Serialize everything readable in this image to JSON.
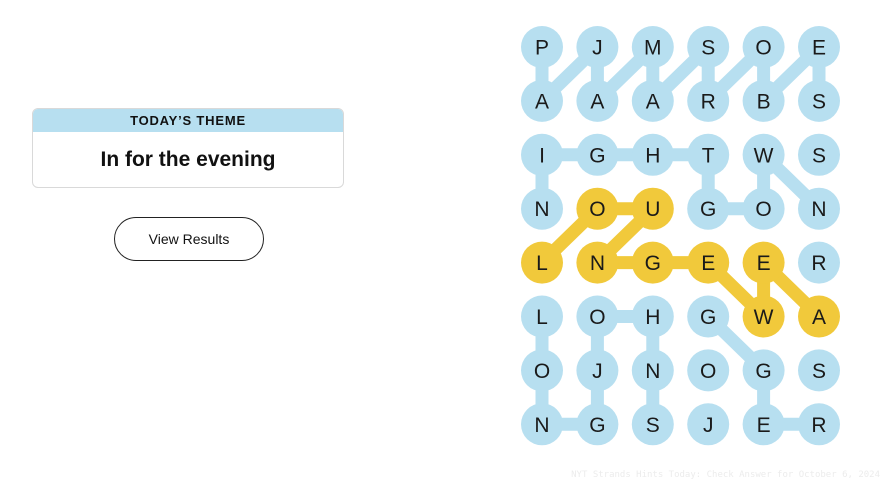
{
  "theme": {
    "header": "TODAY’S THEME",
    "title": "In for the evening"
  },
  "results_button": {
    "label": "View Results"
  },
  "board": {
    "rows": 8,
    "cols": 6,
    "letters": [
      [
        "P",
        "J",
        "M",
        "S",
        "O",
        "E"
      ],
      [
        "A",
        "A",
        "A",
        "R",
        "B",
        "S"
      ],
      [
        "I",
        "G",
        "H",
        "T",
        "W",
        "S"
      ],
      [
        "N",
        "O",
        "U",
        "G",
        "O",
        "N"
      ],
      [
        "L",
        "N",
        "G",
        "E",
        "E",
        "R"
      ],
      [
        "L",
        "O",
        "H",
        "G",
        "W",
        "A"
      ],
      [
        "O",
        "J",
        "N",
        "O",
        "G",
        "S"
      ],
      [
        "N",
        "G",
        "S",
        "J",
        "E",
        "R"
      ]
    ],
    "highlighted": [
      [
        3,
        1
      ],
      [
        3,
        2
      ],
      [
        4,
        0
      ],
      [
        4,
        1
      ],
      [
        4,
        2
      ],
      [
        4,
        3
      ],
      [
        4,
        4
      ],
      [
        5,
        4
      ],
      [
        5,
        5
      ]
    ],
    "links": [
      {
        "from": [
          0,
          0
        ],
        "to": [
          1,
          0
        ],
        "color": "blue"
      },
      {
        "from": [
          1,
          0
        ],
        "to": [
          0,
          1
        ],
        "color": "blue"
      },
      {
        "from": [
          0,
          1
        ],
        "to": [
          1,
          1
        ],
        "color": "blue"
      },
      {
        "from": [
          1,
          1
        ],
        "to": [
          0,
          2
        ],
        "color": "blue"
      },
      {
        "from": [
          0,
          2
        ],
        "to": [
          1,
          2
        ],
        "color": "blue"
      },
      {
        "from": [
          1,
          2
        ],
        "to": [
          0,
          3
        ],
        "color": "blue"
      },
      {
        "from": [
          0,
          3
        ],
        "to": [
          1,
          3
        ],
        "color": "blue"
      },
      {
        "from": [
          1,
          3
        ],
        "to": [
          0,
          4
        ],
        "color": "blue"
      },
      {
        "from": [
          0,
          4
        ],
        "to": [
          1,
          4
        ],
        "color": "blue"
      },
      {
        "from": [
          1,
          4
        ],
        "to": [
          0,
          5
        ],
        "color": "blue"
      },
      {
        "from": [
          0,
          5
        ],
        "to": [
          1,
          5
        ],
        "color": "blue"
      },
      {
        "from": [
          2,
          0
        ],
        "to": [
          2,
          1
        ],
        "color": "blue"
      },
      {
        "from": [
          2,
          1
        ],
        "to": [
          2,
          2
        ],
        "color": "blue"
      },
      {
        "from": [
          2,
          2
        ],
        "to": [
          2,
          3
        ],
        "color": "blue"
      },
      {
        "from": [
          2,
          3
        ],
        "to": [
          3,
          3
        ],
        "color": "blue"
      },
      {
        "from": [
          3,
          3
        ],
        "to": [
          3,
          4
        ],
        "color": "blue"
      },
      {
        "from": [
          3,
          4
        ],
        "to": [
          2,
          4
        ],
        "color": "blue"
      },
      {
        "from": [
          2,
          4
        ],
        "to": [
          3,
          5
        ],
        "color": "blue"
      },
      {
        "from": [
          2,
          0
        ],
        "to": [
          3,
          0
        ],
        "color": "blue"
      },
      {
        "from": [
          5,
          0
        ],
        "to": [
          6,
          0
        ],
        "color": "blue"
      },
      {
        "from": [
          6,
          0
        ],
        "to": [
          7,
          0
        ],
        "color": "blue"
      },
      {
        "from": [
          7,
          0
        ],
        "to": [
          7,
          1
        ],
        "color": "blue"
      },
      {
        "from": [
          7,
          1
        ],
        "to": [
          6,
          1
        ],
        "color": "blue"
      },
      {
        "from": [
          6,
          1
        ],
        "to": [
          5,
          1
        ],
        "color": "blue"
      },
      {
        "from": [
          5,
          1
        ],
        "to": [
          5,
          2
        ],
        "color": "blue"
      },
      {
        "from": [
          5,
          2
        ],
        "to": [
          6,
          2
        ],
        "color": "blue"
      },
      {
        "from": [
          6,
          2
        ],
        "to": [
          7,
          2
        ],
        "color": "blue"
      },
      {
        "from": [
          5,
          3
        ],
        "to": [
          6,
          4
        ],
        "color": "blue"
      },
      {
        "from": [
          6,
          4
        ],
        "to": [
          7,
          4
        ],
        "color": "blue"
      },
      {
        "from": [
          7,
          4
        ],
        "to": [
          7,
          5
        ],
        "color": "blue"
      },
      {
        "from": [
          4,
          0
        ],
        "to": [
          3,
          1
        ],
        "color": "yellow"
      },
      {
        "from": [
          3,
          1
        ],
        "to": [
          3,
          2
        ],
        "color": "yellow"
      },
      {
        "from": [
          3,
          2
        ],
        "to": [
          4,
          1
        ],
        "color": "yellow"
      },
      {
        "from": [
          4,
          1
        ],
        "to": [
          4,
          2
        ],
        "color": "yellow"
      },
      {
        "from": [
          4,
          2
        ],
        "to": [
          4,
          3
        ],
        "color": "yellow"
      },
      {
        "from": [
          4,
          3
        ],
        "to": [
          5,
          4
        ],
        "color": "yellow"
      },
      {
        "from": [
          5,
          4
        ],
        "to": [
          4,
          4
        ],
        "color": "yellow"
      },
      {
        "from": [
          4,
          4
        ],
        "to": [
          5,
          5
        ],
        "color": "yellow"
      }
    ],
    "colors": {
      "blue": "#b7dff0",
      "yellow": "#f1c93b"
    }
  },
  "watermark": "NYT Strands Hints Today: Check Answer for October 6, 2024"
}
